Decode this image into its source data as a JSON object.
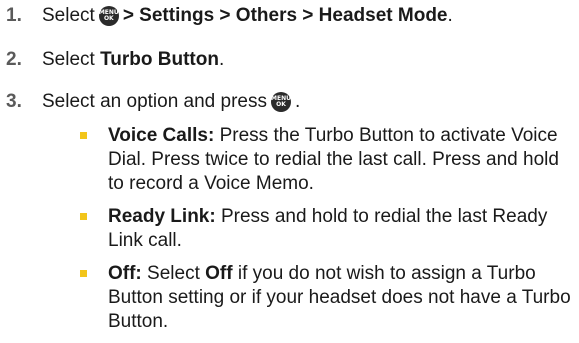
{
  "steps": [
    {
      "number": "1.",
      "prefix": "Select",
      "path": "> Settings > Others > Headset Mode",
      "suffix": "."
    },
    {
      "number": "2.",
      "prefix": "Select",
      "bold": "Turbo Button",
      "suffix": "."
    },
    {
      "number": "3.",
      "prefix": "Select an option and press",
      "suffix": "."
    }
  ],
  "menu_key": {
    "icon": "menu-ok-key-icon",
    "line1": "MENU",
    "line2": "OK"
  },
  "options": [
    {
      "term": "Voice Calls:",
      "desc": "Press the Turbo Button to activate Voice Dial. Press twice to redial the last call. Press and hold to record a Voice Memo."
    },
    {
      "term": "Ready Link:",
      "desc": "Press and hold to redial the last Ready Link call."
    },
    {
      "term": "Off:",
      "desc_pre": "Select",
      "desc_bold": "Off",
      "desc_post": "if you do not wish to assign a Turbo Button setting or if your headset does not have a Turbo Button."
    }
  ],
  "colors": {
    "bullet": "#f2c51a",
    "step_number": "#5a5a5a",
    "text": "#1a1a1a"
  }
}
